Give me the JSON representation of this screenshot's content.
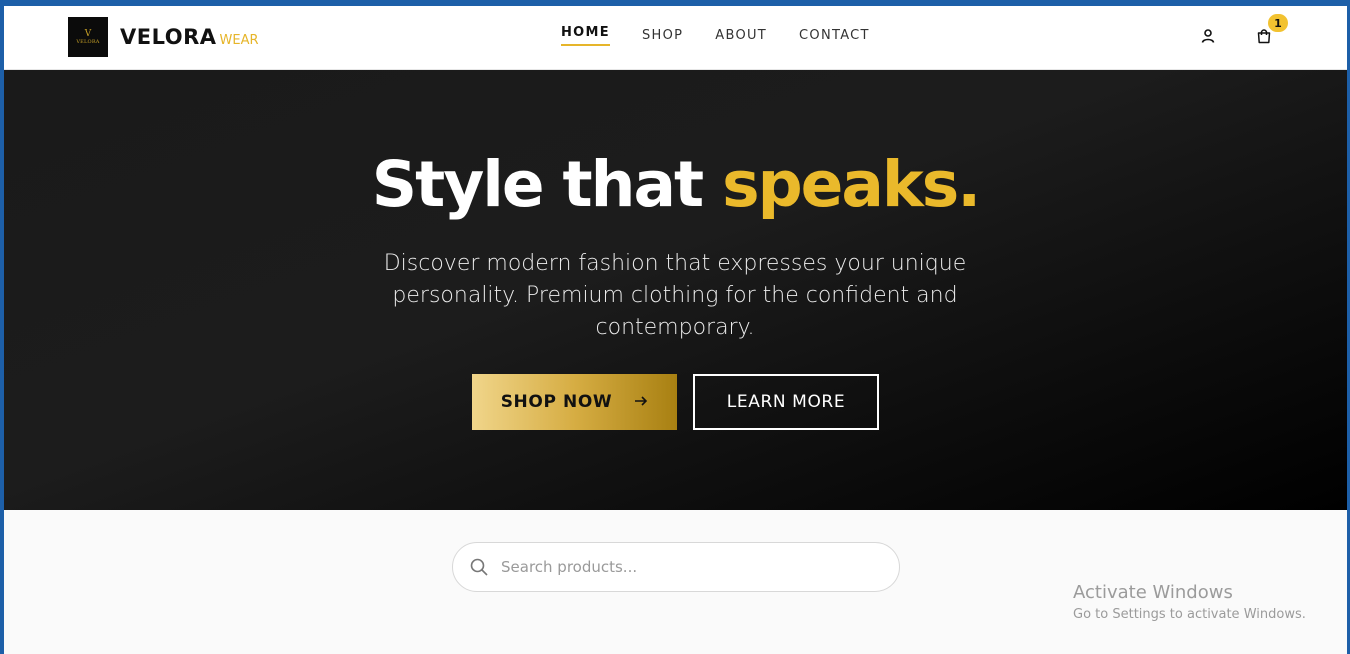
{
  "header": {
    "logo": {
      "mark": "V",
      "mini": "VELORA"
    },
    "brand_main": "VELORA",
    "brand_sub": "WEAR",
    "nav": [
      {
        "label": "HOME",
        "active": true
      },
      {
        "label": "SHOP",
        "active": false
      },
      {
        "label": "ABOUT",
        "active": false
      },
      {
        "label": "CONTACT",
        "active": false
      }
    ],
    "icons": {
      "account": "user-icon",
      "cart": "shopping-bag-icon"
    },
    "cart_count": "1"
  },
  "hero": {
    "title_plain": "Style that ",
    "title_accent": "speaks.",
    "subtitle": "Discover modern fashion that expresses your unique personality. Premium clothing for the confident and contemporary.",
    "primary_cta": "SHOP NOW",
    "primary_cta_icon": "arrow-right-icon",
    "secondary_cta": "LEARN MORE"
  },
  "search": {
    "placeholder": "Search products...",
    "value": ""
  },
  "watermark": {
    "title": "Activate Windows",
    "subtitle": "Go to Settings to activate Windows."
  },
  "colors": {
    "accent": "#eab92b",
    "hero_bg": "#1a1a1a",
    "badge": "#f2c230"
  }
}
